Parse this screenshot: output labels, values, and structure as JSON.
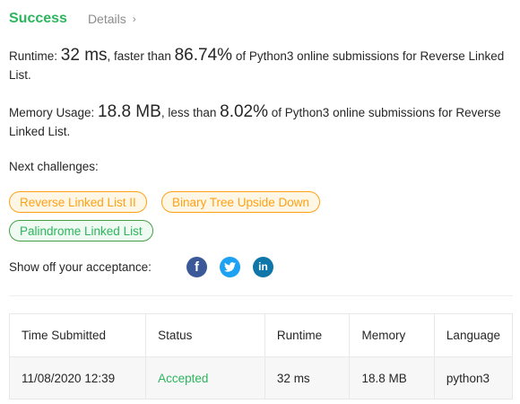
{
  "header": {
    "status": "Success",
    "details_link": "Details",
    "chevron": "›"
  },
  "runtime": {
    "label": "Runtime:",
    "value": "32 ms",
    "comparison": ", faster than",
    "percent": "86.74%",
    "suffix": "of Python3 online submissions for Reverse Linked List."
  },
  "memory": {
    "label": "Memory Usage:",
    "value": "18.8 MB",
    "comparison": ", less than",
    "percent": "8.02%",
    "suffix": "of Python3 online submissions for Reverse Linked List."
  },
  "next_challenges": {
    "label": "Next challenges:",
    "items": [
      "Reverse Linked List II",
      "Binary Tree Upside Down",
      "Palindrome Linked List"
    ],
    "colors": [
      "#ffa116",
      "#ffa116",
      "#2db55d"
    ]
  },
  "share": {
    "label": "Show off your acceptance:",
    "icons": [
      "facebook-icon",
      "twitter-icon",
      "linkedin-icon"
    ],
    "glyphs": [
      "f",
      "t",
      "in"
    ]
  },
  "submissions_table": {
    "headers": [
      "Time Submitted",
      "Status",
      "Runtime",
      "Memory",
      "Language"
    ],
    "rows": [
      [
        "11/08/2020 12:39",
        "Accepted",
        "32 ms",
        "18.8 MB",
        "python3"
      ]
    ]
  },
  "colors": {
    "success": "#2db55d",
    "medium": "#ffa116",
    "facebook": "#3b5998",
    "twitter": "#1da1f2",
    "linkedin": "#0e76a8"
  }
}
